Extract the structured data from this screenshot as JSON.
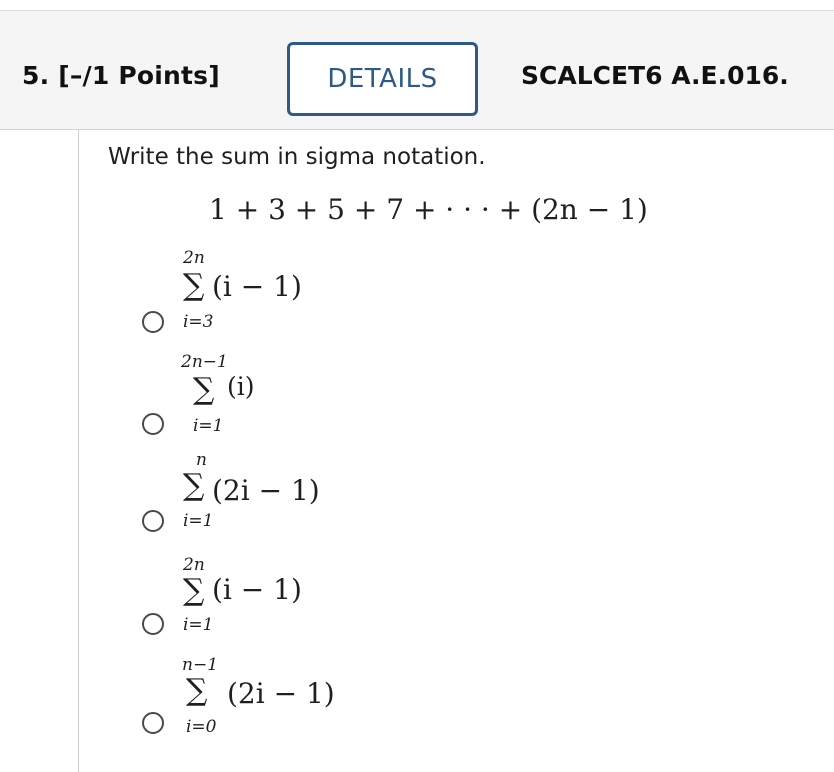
{
  "header": {
    "question_label": "5. [–/1 Points]",
    "details_button": "DETAILS",
    "reference": "SCALCET6 A.E.016."
  },
  "question": {
    "prompt": "Write the sum in sigma notation.",
    "expression": "1 + 3 + 5 + 7 + · · · + (2n − 1)"
  },
  "choices": [
    {
      "upper": "2n",
      "lower": "i=3",
      "term": "(i − 1)",
      "selected": false
    },
    {
      "upper": "2n−1",
      "lower": "i=1",
      "term": "(i)",
      "selected": false
    },
    {
      "upper": "n",
      "lower": "i=1",
      "term": "(2i − 1)",
      "selected": false
    },
    {
      "upper": "2n",
      "lower": "i=1",
      "term": "(i − 1)",
      "selected": false
    },
    {
      "upper": "n−1",
      "lower": "i=0",
      "term": "(2i − 1)",
      "selected": false
    }
  ],
  "sigma_symbol": "∑",
  "colors": {
    "accent": "#2e5a88",
    "header_bg": "#f5f5f5"
  }
}
